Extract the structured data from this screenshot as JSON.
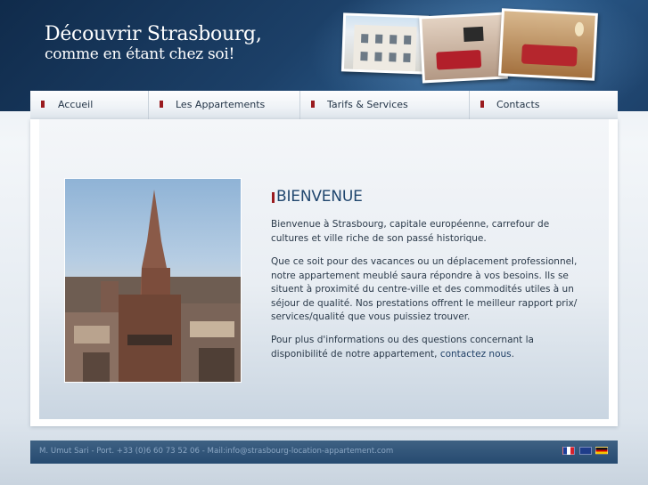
{
  "header": {
    "title": "Découvrir Strasbourg,",
    "subtitle": "comme en étant chez soi!"
  },
  "nav": {
    "items": [
      {
        "label": "Accueil",
        "icon": "bullet-icon"
      },
      {
        "label": "Les Appartements",
        "icon": "bullet-icon"
      },
      {
        "label": "Tarifs & Services",
        "icon": "bullet-icon"
      },
      {
        "label": "Contacts",
        "icon": "bullet-icon"
      }
    ]
  },
  "main": {
    "heading": "BIENVENUE",
    "paragraph1": "Bienvenue à Strasbourg, capitale européenne, carrefour de cultures et ville riche de son passé historique.",
    "paragraph2": "Que ce soit pour des vacances ou un déplacement professionnel, notre appartement meublé saura répondre à vos besoins. Ils se situent à proximité du centre-ville et des commodités utiles à un séjour de qualité. Nos prestations offrent le meilleur rapport prix/ services/qualité que vous puissiez trouver.",
    "paragraph3_before": "Pour plus d'informations ou des questions concernant la disponibilité de notre appartement, ",
    "paragraph3_link": "contactez nous",
    "paragraph3_after": "."
  },
  "footer": {
    "text": "M. Umut Sari - Port. +33 (0)6 60 73 52 06 - Mail:info@strasbourg-location-appartement.com",
    "flags": [
      "flag-fr-icon",
      "flag-uk-icon",
      "flag-de-icon"
    ]
  },
  "colors": {
    "header_dark": "#102b4b",
    "accent_red": "#9a1b1f",
    "heading_blue": "#20466e",
    "footer_bg": "#2e527a"
  }
}
